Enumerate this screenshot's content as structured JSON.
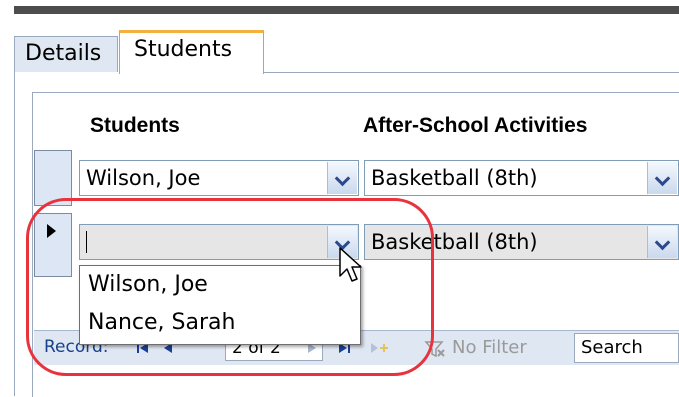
{
  "tabs": [
    {
      "label": "Details",
      "active": false
    },
    {
      "label": "Students",
      "active": true
    }
  ],
  "form": {
    "columns": {
      "students": "Students",
      "activities": "After-School Activities"
    },
    "rows": [
      {
        "student": "Wilson, Joe",
        "activity": "Basketball (8th)"
      },
      {
        "student": "",
        "activity": "Basketball (8th)"
      }
    ],
    "dropdown_options": [
      "Wilson, Joe",
      "Nance, Sarah"
    ]
  },
  "navigation": {
    "record_label": "Record:",
    "position": "2 of 2",
    "filter_label": "No Filter",
    "search_label": "Search"
  },
  "colors": {
    "active_tab_accent": "#f4b13e",
    "highlight": "#e8323c",
    "selector": "#dce6f4"
  }
}
